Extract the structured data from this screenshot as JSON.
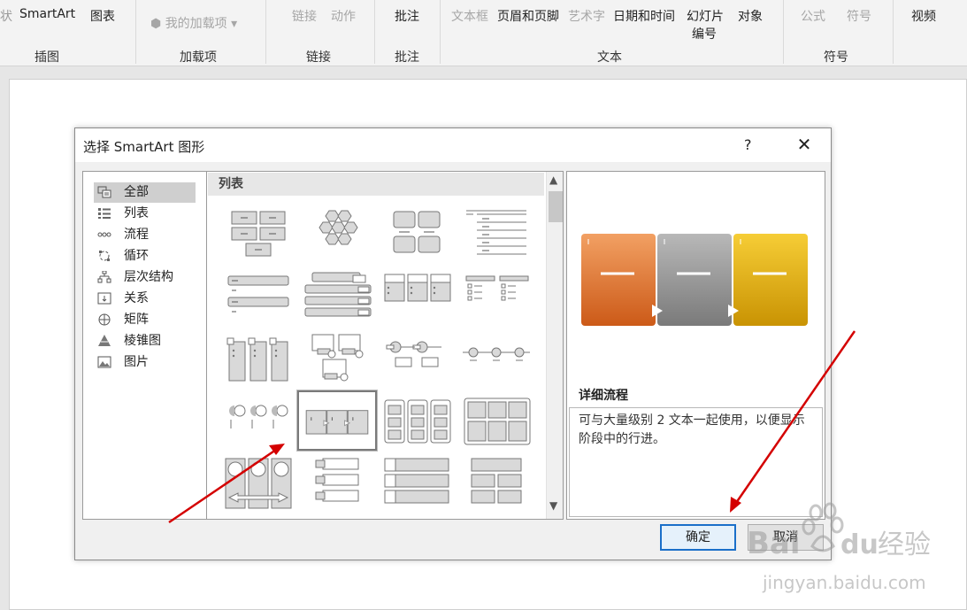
{
  "ribbon": {
    "items": [
      "SmartArt",
      "图表",
      "我的加载项",
      "链接",
      "动作",
      "批注",
      "文本框",
      "页眉和页脚",
      "艺术字",
      "日期和时间",
      "幻灯片",
      "编号",
      "对象",
      "公式",
      "符号",
      "视频"
    ],
    "groups": [
      "插图",
      "加载项",
      "链接",
      "批注",
      "文本",
      "符号"
    ]
  },
  "dialog": {
    "title": "选择 SmartArt 图形",
    "help": "?",
    "close": "✕",
    "categories": [
      {
        "label": "全部",
        "icon": "all-icon"
      },
      {
        "label": "列表",
        "icon": "list-icon"
      },
      {
        "label": "流程",
        "icon": "process-icon"
      },
      {
        "label": "循环",
        "icon": "cycle-icon"
      },
      {
        "label": "层次结构",
        "icon": "hierarchy-icon"
      },
      {
        "label": "关系",
        "icon": "relationship-icon"
      },
      {
        "label": "矩阵",
        "icon": "matrix-icon"
      },
      {
        "label": "棱锥图",
        "icon": "pyramid-icon"
      },
      {
        "label": "图片",
        "icon": "picture-icon"
      }
    ],
    "selected_category": "全部",
    "gallery_header": "列表",
    "preview": {
      "name": "详细流程",
      "description": "可与大量级别 2 文本一起使用，以便显示阶段中的行进。",
      "colors": [
        "#e27b3a",
        "#9a9a9a",
        "#e6b00f"
      ]
    },
    "ok_label": "确定",
    "cancel_label": "取消"
  },
  "watermark": {
    "text1": "Bai",
    "text2": "du",
    "text3": "经验",
    "url": "jingyan.baidu.com"
  }
}
